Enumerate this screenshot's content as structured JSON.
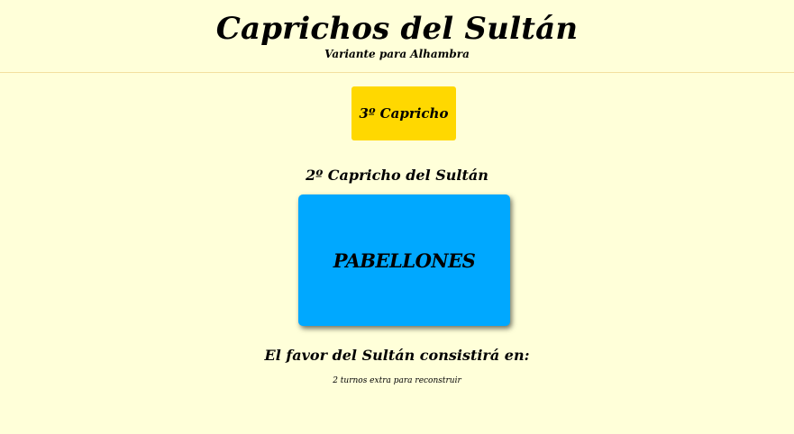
{
  "header": {
    "title": "Caprichos del Sultán",
    "subtitle": "Variante para Alhambra"
  },
  "capricho_button": {
    "label": "3º Capricho",
    "color": "#ffd800"
  },
  "current": {
    "heading": "2º Capricho del Sultán",
    "card_label": "PABELLONES",
    "card_color": "#00a8ff"
  },
  "favor": {
    "heading": "El favor del Sultán consistirá en:",
    "text": "2 turnos extra para reconstruir"
  },
  "colors": {
    "background": "#ffffd9"
  }
}
